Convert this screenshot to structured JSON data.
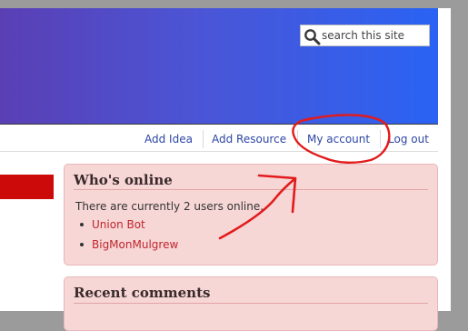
{
  "search": {
    "placeholder": "search this site"
  },
  "nav": {
    "add_idea": "Add Idea",
    "add_resource": "Add Resource",
    "my_account": "My account",
    "log_out": "Log out"
  },
  "whos_online": {
    "title": "Who's online",
    "summary": "There are currently 2 users online.",
    "users": [
      "Union Bot",
      "BigMonMulgrew"
    ]
  },
  "recent_comments": {
    "title": "Recent comments"
  },
  "colors": {
    "header_gradient_start": "#5a3fb4",
    "header_gradient_end": "#2a63f3",
    "link": "#2c46a4",
    "user_link": "#c0272d",
    "block_bg": "#f7d6d6",
    "annotation": "#e21b1b"
  },
  "icons": {
    "search": "magnifier-icon"
  }
}
